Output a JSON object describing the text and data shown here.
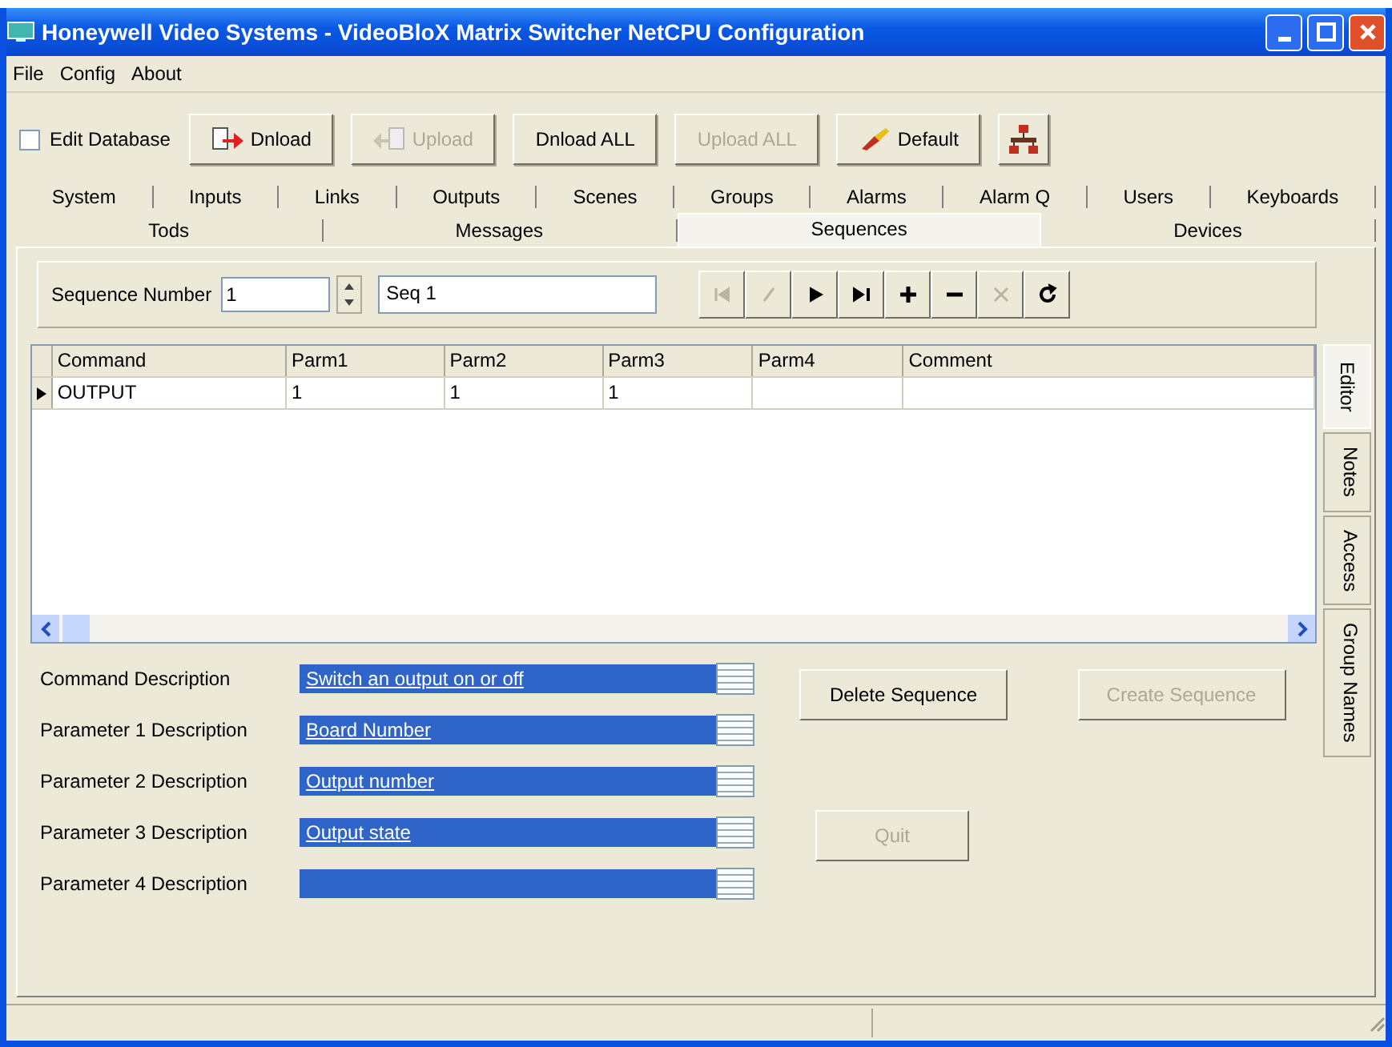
{
  "window": {
    "title": "Honeywell Video Systems - VideoBloX Matrix Switcher NetCPU Configuration"
  },
  "menu": [
    "File",
    "Config",
    "About"
  ],
  "toolbar": {
    "edit_database": {
      "label": "Edit Database",
      "checked": false
    },
    "buttons": [
      {
        "kind": "download",
        "label": "Dnload",
        "disabled": false
      },
      {
        "kind": "upload",
        "label": "Upload",
        "disabled": true
      },
      {
        "kind": "text",
        "label": "Dnload ALL",
        "disabled": false
      },
      {
        "kind": "text",
        "label": "Upload ALL",
        "disabled": true
      },
      {
        "kind": "default",
        "label": "Default",
        "disabled": false
      },
      {
        "kind": "tool"
      }
    ]
  },
  "tabs_row_1": [
    {
      "label": "System",
      "selected": false
    },
    {
      "label": "Inputs",
      "selected": false
    },
    {
      "label": "Links",
      "selected": false
    },
    {
      "label": "Outputs",
      "selected": false
    },
    {
      "label": "Scenes",
      "selected": false
    },
    {
      "label": "Groups",
      "selected": false
    },
    {
      "label": "Alarms",
      "selected": false
    },
    {
      "label": "Alarm Q",
      "selected": false
    },
    {
      "label": "Users",
      "selected": false
    },
    {
      "label": "Keyboards",
      "selected": false
    }
  ],
  "tabs_row_2": [
    {
      "label": "Tods",
      "selected": false
    },
    {
      "label": "Messages",
      "selected": false
    },
    {
      "label": "Sequences",
      "selected": true
    },
    {
      "label": "Devices",
      "selected": false
    }
  ],
  "sequence": {
    "label": "Sequence Number",
    "number": "1",
    "name": "Seq 1"
  },
  "navigator": [
    {
      "kind": "first",
      "disabled": true
    },
    {
      "kind": "prior",
      "disabled": true
    },
    {
      "kind": "next",
      "disabled": false
    },
    {
      "kind": "last",
      "disabled": false
    },
    {
      "kind": "insert",
      "disabled": false
    },
    {
      "kind": "delete",
      "disabled": false
    },
    {
      "kind": "cancel",
      "disabled": true
    },
    {
      "kind": "refresh",
      "disabled": false
    }
  ],
  "grid": {
    "columns": [
      "Command",
      "Parm1",
      "Parm2",
      "Parm3",
      "Parm4",
      "Comment"
    ],
    "rows": [
      {
        "selected": true,
        "cells": [
          "OUTPUT",
          "1",
          "1",
          "1"
        ]
      }
    ]
  },
  "side_tabs": [
    {
      "label": "Editor",
      "selected": true
    },
    {
      "label": "Notes",
      "selected": false
    },
    {
      "label": "Access",
      "selected": false
    },
    {
      "label": "Group Names",
      "selected": false
    }
  ],
  "descriptions": [
    {
      "label": "Command Description",
      "value": "Switch an output on or off"
    },
    {
      "label": "Parameter 1 Description",
      "value": "Board Number"
    },
    {
      "label": "Parameter 2 Description",
      "value": "Output number"
    },
    {
      "label": "Parameter 3 Description",
      "value": "Output state"
    },
    {
      "label": "Parameter 4 Description"
    }
  ],
  "actions": [
    {
      "label": "Delete Sequence",
      "disabled": false
    },
    {
      "label": "Create Sequence",
      "disabled": true
    },
    {
      "label": "Quit",
      "disabled": true
    }
  ]
}
